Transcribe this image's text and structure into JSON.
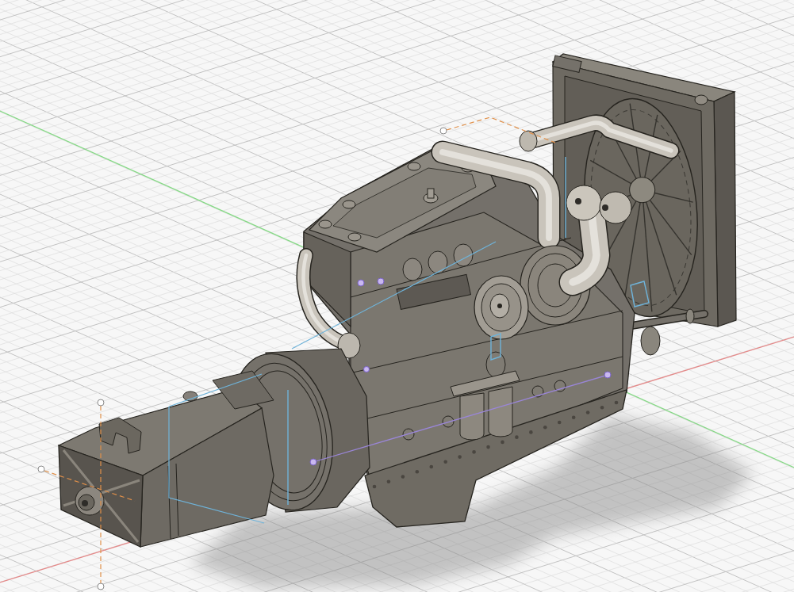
{
  "viewport": {
    "grid": true,
    "shadow": true,
    "axes": [
      {
        "color": "#86d986"
      },
      {
        "color": "#e48a8a"
      }
    ]
  }
}
